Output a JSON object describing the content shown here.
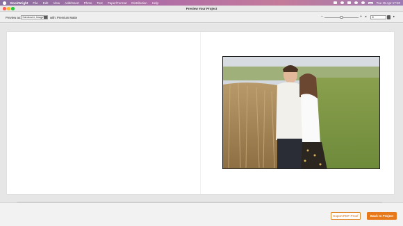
{
  "menubar": {
    "app_name": "BookWright",
    "items": [
      "File",
      "Edit",
      "View",
      "Add/Insert",
      "Photo",
      "Text",
      "Paper/Format",
      "Distribution",
      "Help"
    ],
    "clock": "Tue 15 Apr  17:20",
    "icons": [
      "apple-icon",
      "dropbox-icon",
      "bluetooth-icon",
      "wifi-icon",
      "search-icon",
      "user-icon",
      "control-center-icon"
    ]
  },
  "window": {
    "title": "Preview Your Project"
  },
  "toolbar": {
    "preview_as_label": "Preview as:",
    "cover_type": "Hardcover, ImageWrap",
    "with_label": "with:",
    "finish": "Premium Matte",
    "zoom_out": "−",
    "zoom_in": "+",
    "page_number": "8",
    "prev_arrow": "◂",
    "next_arrow": "▸",
    "zoom_level": 0.5
  },
  "footer": {
    "export_label": "Export PDF Proof",
    "back_label": "Back to Project"
  },
  "colors": {
    "accent": "#e8791b",
    "accent_border": "#e08a2c"
  }
}
